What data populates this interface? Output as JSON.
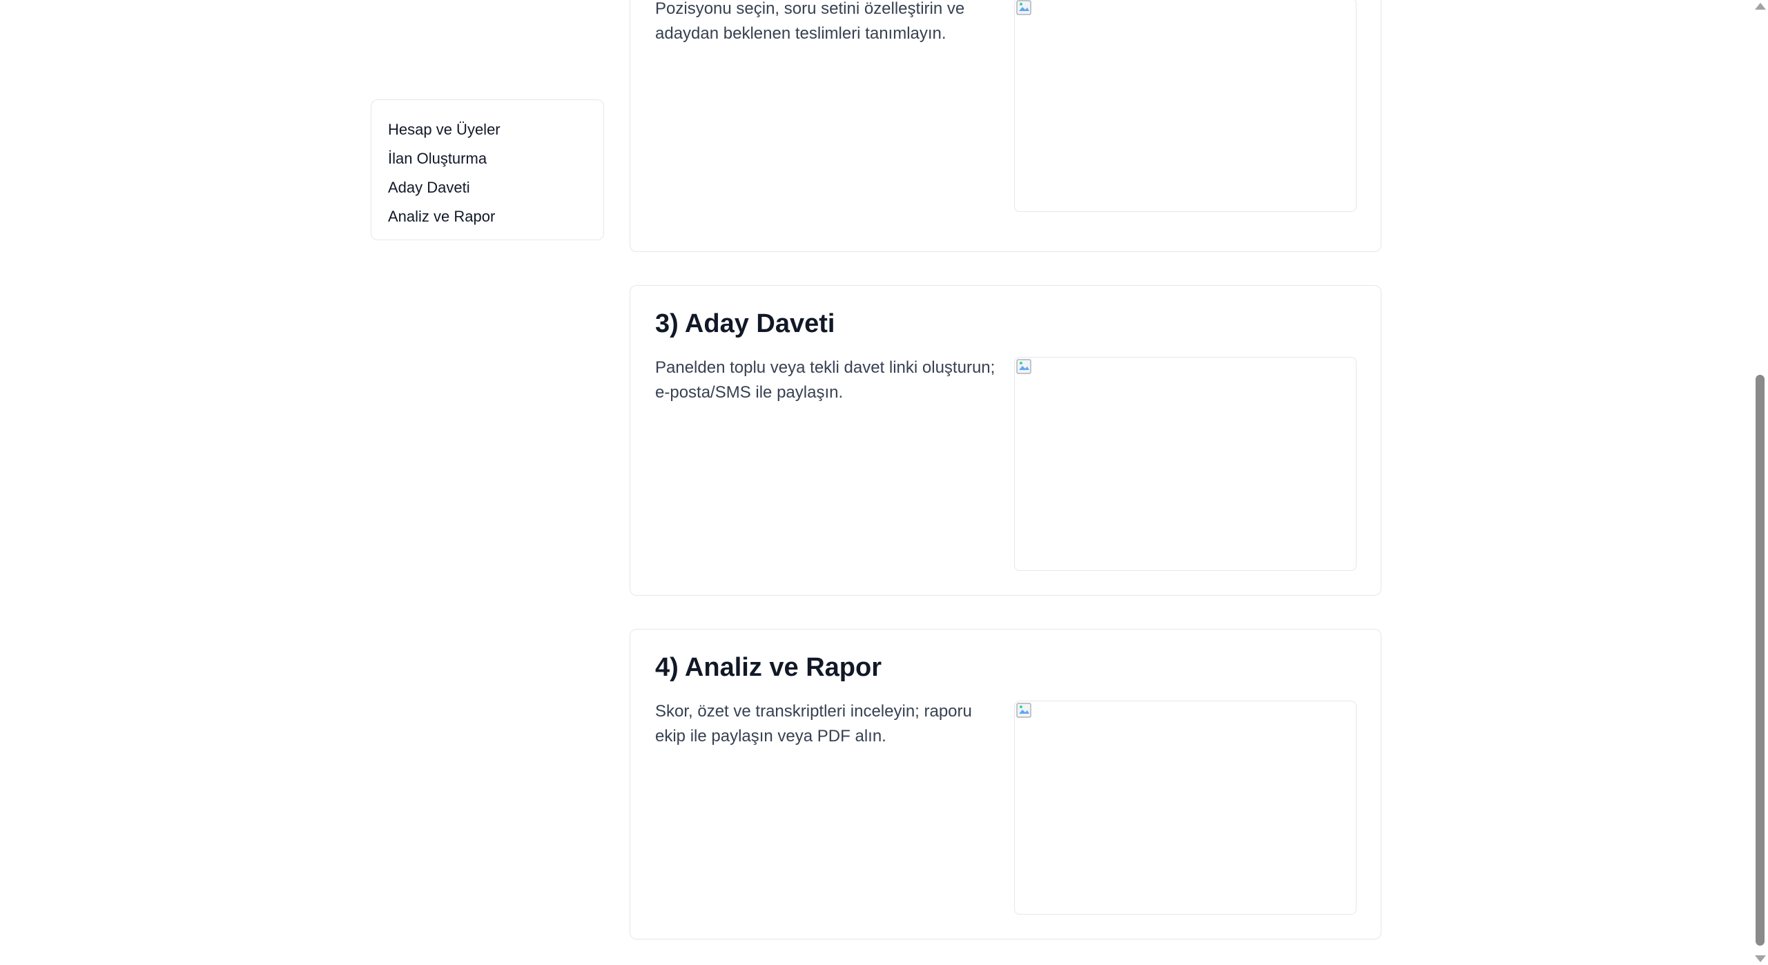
{
  "sidebar": {
    "items": [
      {
        "label": "Hesap ve Üyeler"
      },
      {
        "label": "İlan Oluşturma"
      },
      {
        "label": "Aday Daveti"
      },
      {
        "label": "Analiz ve Rapor"
      }
    ]
  },
  "sections": [
    {
      "title": "",
      "description": "Pozisyonu seçin, soru setini özelleştirin ve adaydan beklenen teslimleri tanımlayın."
    },
    {
      "title": "3) Aday Daveti",
      "description": "Panelden toplu veya tekli davet linki oluşturun; e-posta/SMS ile paylaşın."
    },
    {
      "title": "4) Analiz ve Rapor",
      "description": "Skor, özet ve transkriptleri inceleyin; raporu ekip ile paylaşın veya PDF alın."
    }
  ],
  "icons": {
    "image_placeholder": "broken-image-icon",
    "scroll_up": "chevron-up-icon",
    "scroll_down": "chevron-down-icon"
  },
  "colors": {
    "border": "#e5e7eb",
    "text": "#111827",
    "muted_text": "#374151",
    "scroll_thumb": "#8a8a8a"
  }
}
